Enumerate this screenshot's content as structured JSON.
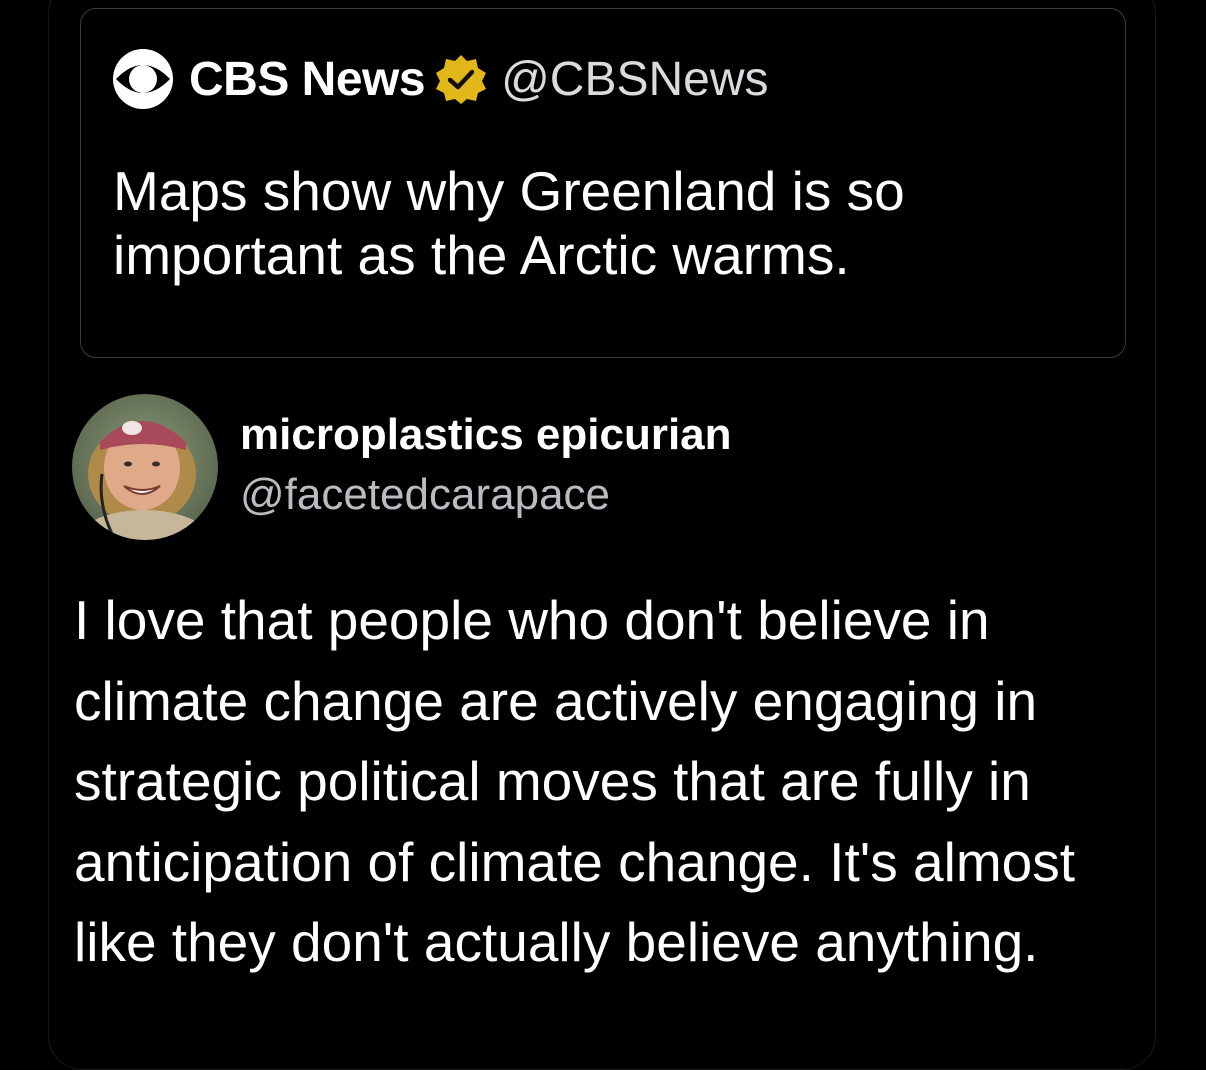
{
  "quoted_tweet": {
    "author_name": "CBS News",
    "author_handle": "@CBSNews",
    "logo_icon": "cbs-eye-logo-icon",
    "badge_icon": "verified-gold-badge-icon",
    "badge_color": "#e2b719",
    "text": "Maps show why Greenland is so important as the Arctic warms."
  },
  "tweet": {
    "author_name": "microplastics epicurian",
    "author_handle": "@facetedcarapace",
    "avatar_icon": "profile-photo-avatar",
    "text": "I love that people who don't believe in climate change are actively engaging in strategic political moves that are fully in anticipation of climate change. It's almost like they don't actually believe anything."
  }
}
